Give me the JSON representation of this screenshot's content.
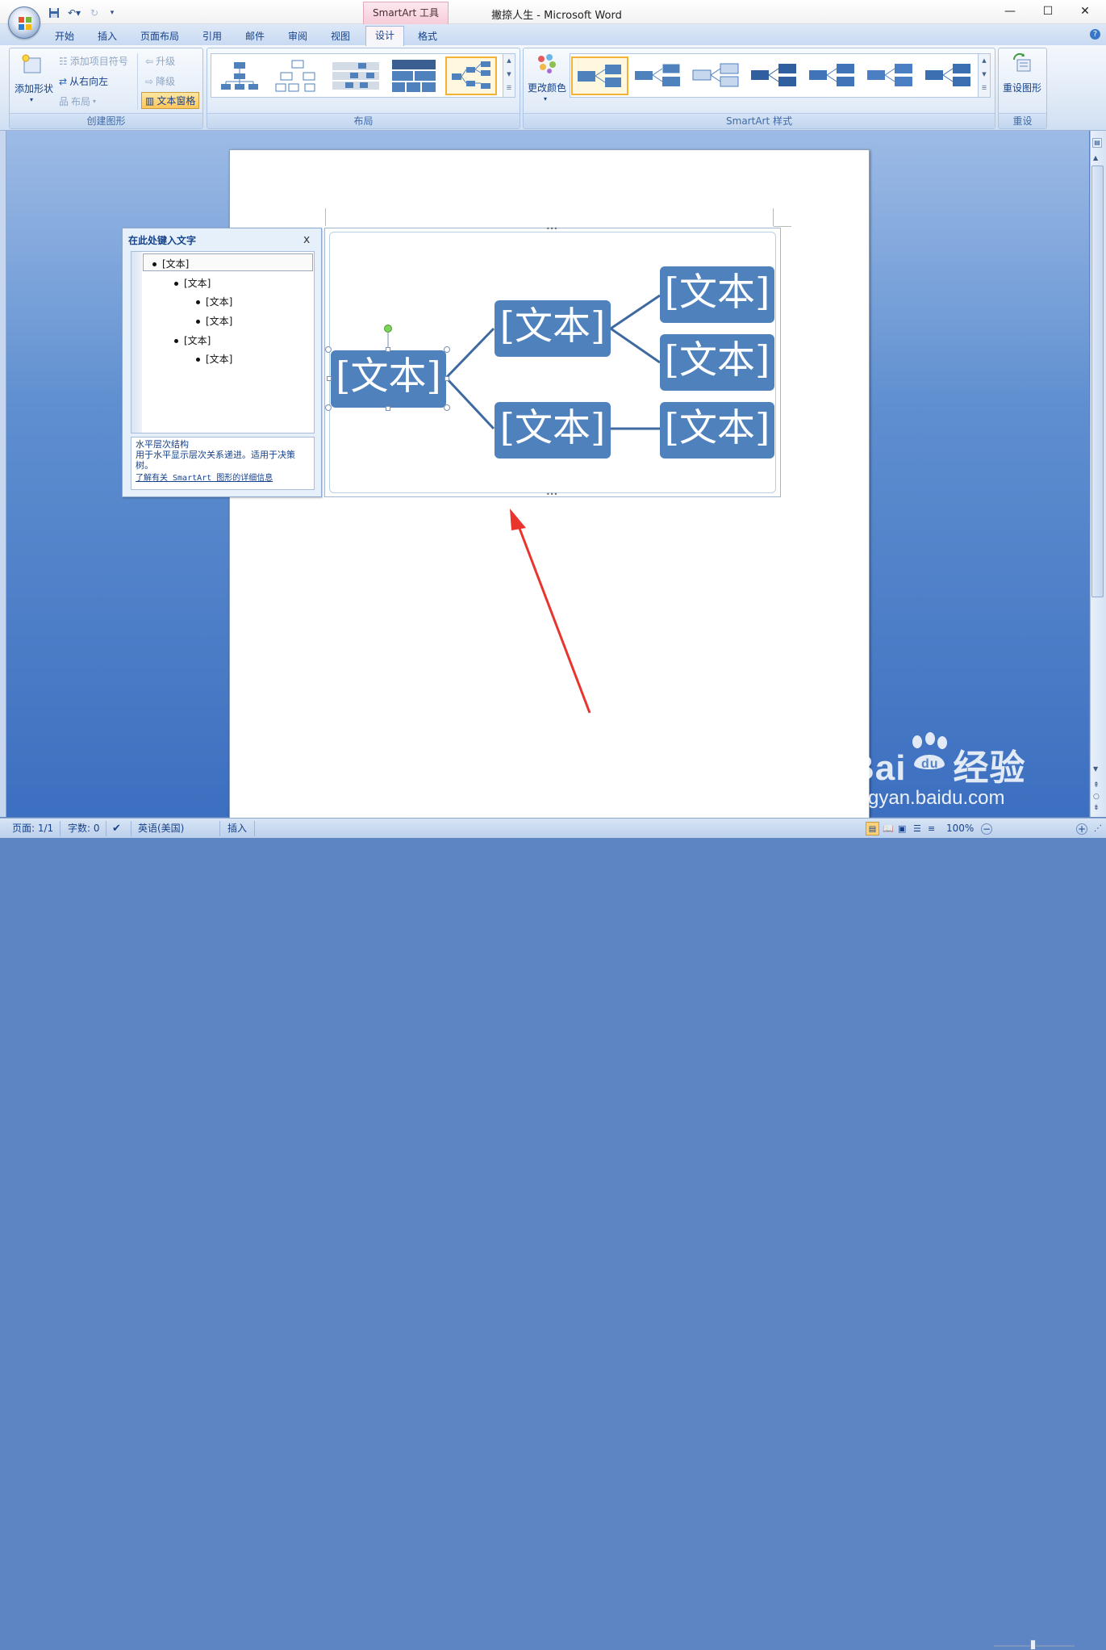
{
  "window": {
    "title": "撇捺人生 - Microsoft Word",
    "context_tab": "SmartArt 工具",
    "minimize": "—",
    "maximize": "☐",
    "close": "✕"
  },
  "tabs": [
    "开始",
    "插入",
    "页面布局",
    "引用",
    "邮件",
    "审阅",
    "视图",
    "设计",
    "格式"
  ],
  "ribbon": {
    "create_group": {
      "label": "创建图形",
      "add_shape": "添加形状",
      "add_bullet": "添加项目符号",
      "right_to_left": "从右向左",
      "layout": "布局",
      "promote": "升级",
      "demote": "降级",
      "text_pane": "文本窗格"
    },
    "layout_group": {
      "label": "布局"
    },
    "styles_group": {
      "label": "SmartArt 样式",
      "change_colors": "更改颜色"
    },
    "reset_group": {
      "label": "重设",
      "reset_graphic": "重设图形"
    }
  },
  "text_pane": {
    "title": "在此处键入文字",
    "close": "x",
    "items": [
      "[文本]",
      "[文本]",
      "[文本]",
      "[文本]",
      "[文本]",
      "[文本]"
    ],
    "desc_title": "水平层次结构",
    "desc_body": "用于水平显示层次关系递进。适用于决策树。",
    "link": "了解有关 SmartArt 图形的详细信息"
  },
  "smartart": {
    "nodes": [
      "[文本]",
      "[文本]",
      "[文本]",
      "[文本]",
      "[文本]",
      "[文本]"
    ],
    "fill_color": "#4f81bd",
    "line_color": "#3f6aa0"
  },
  "annotation": {
    "arrow_color": "#e8352e"
  },
  "status": {
    "page": "页面: 1/1",
    "words": "字数: 0",
    "language": "英语(美国)",
    "mode": "插入",
    "zoom": "100%"
  },
  "watermark": {
    "brand": "Baidu经验",
    "url": "jingyan.baidu.com"
  }
}
